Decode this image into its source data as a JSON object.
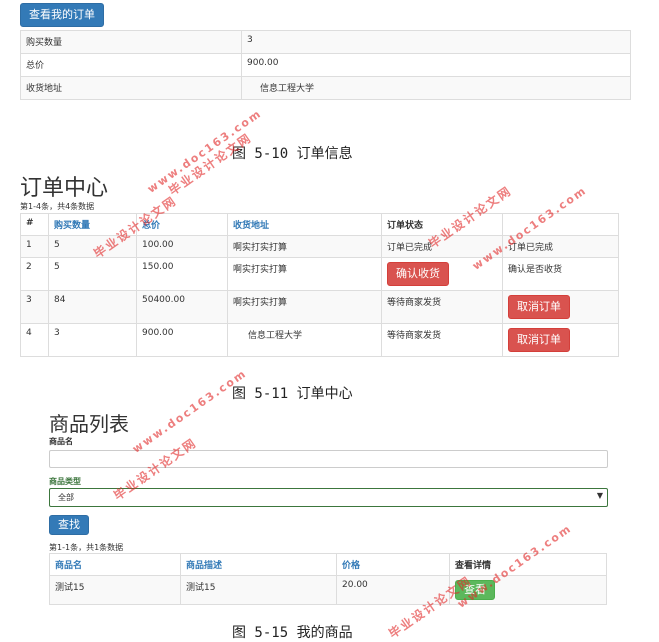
{
  "order_info": {
    "view_button": "查看我的订单",
    "rows": [
      {
        "label": "购买数量",
        "value": "3"
      },
      {
        "label": "总价",
        "value": "900.00"
      },
      {
        "label": "收货地址",
        "value": "信息工程大学"
      }
    ],
    "caption": "图 5-10 订单信息"
  },
  "order_center": {
    "title": "订单中心",
    "summary": "第1-4条，共4条数据",
    "headers": [
      "#",
      "购买数量",
      "总价",
      "收货地址",
      "订单状态",
      ""
    ],
    "rows": [
      {
        "id": "1",
        "qty": "5",
        "total": "100.00",
        "addr": "啊实打实打算",
        "status": "订单已完成",
        "action_text": "订单已完成",
        "action_btn": ""
      },
      {
        "id": "2",
        "qty": "5",
        "total": "150.00",
        "addr": "啊实打实打算",
        "status": "",
        "action_text": "确认是否收货",
        "action_btn": "",
        "status_btn": "确认收货"
      },
      {
        "id": "3",
        "qty": "84",
        "total": "50400.00",
        "addr": "啊实打实打算",
        "status": "等待商家发货",
        "action_text": "",
        "action_btn": "取消订单"
      },
      {
        "id": "4",
        "qty": "3",
        "total": "900.00",
        "addr": "信息工程大学",
        "status": "等待商家发货",
        "action_text": "",
        "action_btn": "取消订单"
      }
    ],
    "caption": "图 5-11 订单中心"
  },
  "products": {
    "title": "商品列表",
    "name_label": "商品名",
    "name_value": "",
    "type_label": "商品类型",
    "type_value": "全部",
    "search_button": "查找",
    "summary": "第1-1条，共1条数据",
    "headers": [
      "商品名",
      "商品描述",
      "价格",
      "查看详情"
    ],
    "rows": [
      {
        "name": "测试15",
        "desc": "测试15",
        "price": "20.00",
        "button": "查看"
      }
    ],
    "caption": "图 5-15 我的商品"
  },
  "watermarks": {
    "a": "毕业设计论文网",
    "b": "www.doc163.com"
  },
  "colors": {
    "primary": "#337ab7",
    "danger": "#d9534f",
    "success": "#5cb85c",
    "watermark": "#e12828"
  }
}
